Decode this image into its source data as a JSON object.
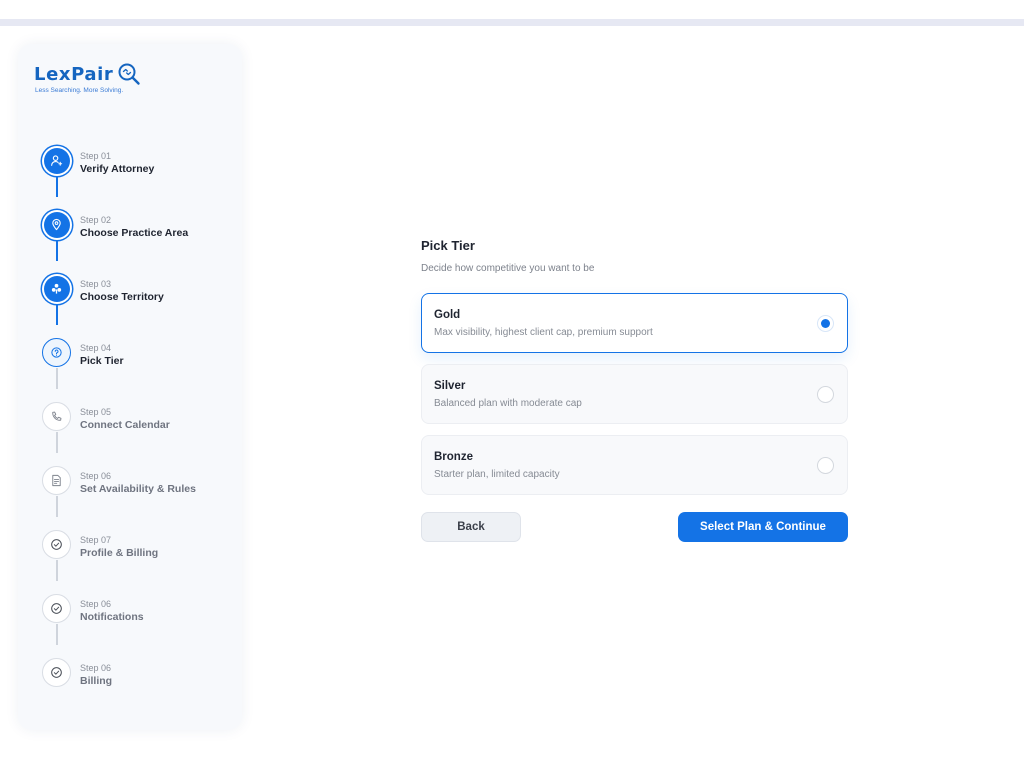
{
  "brand": {
    "name": "LexPair",
    "tagline": "Less Searching. More Solving.",
    "accent": "#1473e6"
  },
  "steps": [
    {
      "index": "Step 01",
      "label": "Verify Attorney",
      "state": "done",
      "icon": "user-icon"
    },
    {
      "index": "Step 02",
      "label": "Choose Practice Area",
      "state": "done",
      "icon": "location-pin-icon"
    },
    {
      "index": "Step 03",
      "label": "Choose Territory",
      "state": "done",
      "icon": "territory-icon"
    },
    {
      "index": "Step 04",
      "label": "Pick Tier",
      "state": "active",
      "icon": "tier-icon"
    },
    {
      "index": "Step 05",
      "label": "Connect Calendar",
      "state": "pending",
      "icon": "phone-icon"
    },
    {
      "index": "Step 06",
      "label": "Set Availability & Rules",
      "state": "pending",
      "icon": "document-icon"
    },
    {
      "index": "Step 07",
      "label": "Profile & Billing",
      "state": "pending",
      "icon": "check-circle-icon"
    },
    {
      "index": "Step 06",
      "label": "Notifications",
      "state": "pending",
      "icon": "check-circle-icon"
    },
    {
      "index": "Step 06",
      "label": "Billing",
      "state": "pending",
      "icon": "check-circle-icon"
    }
  ],
  "main": {
    "title": "Pick Tier",
    "subtitle": "Decide how competitive you want to be",
    "tiers": [
      {
        "name": "Gold",
        "description": "Max visibility, highest client cap, premium support",
        "selected": true
      },
      {
        "name": "Silver",
        "description": "Balanced plan with moderate cap",
        "selected": false
      },
      {
        "name": "Bronze",
        "description": "Starter plan, limited capacity",
        "selected": false
      }
    ],
    "back_label": "Back",
    "continue_label": "Select Plan & Continue"
  }
}
